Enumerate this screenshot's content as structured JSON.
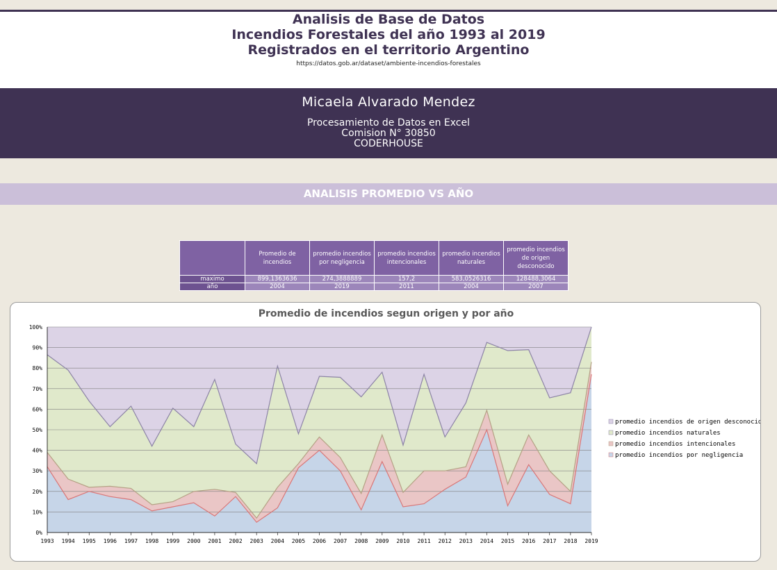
{
  "header": {
    "title_lines": [
      "Analisis de Base de Datos",
      "Incendios Forestales del año 1993 al 2019",
      "Registrados en el territorio Argentino"
    ],
    "source_url": "https://datos.gob.ar/dataset/ambiente-incendios-forestales"
  },
  "author": {
    "name": "Micaela Alvarado Mendez",
    "course_lines": [
      "Procesamiento de Datos en Excel",
      "Comision N° 30850",
      "CODERHOUSE"
    ]
  },
  "section": {
    "title": "ANALISIS PROMEDIO VS AÑO"
  },
  "summary_table": {
    "columns": [
      "",
      "Promedio de incendios",
      "promedio incendios por negligencia",
      "promedio incendios intencionales",
      "promedio incendios naturales",
      "promedio incendios de origen desconocido"
    ],
    "rows": [
      {
        "label": "maximo",
        "values": [
          "899,1363636",
          "274,3888889",
          "157,2",
          "583,0526316",
          "128488,3064"
        ]
      },
      {
        "label": "año",
        "values": [
          "2004",
          "2019",
          "2011",
          "2004",
          "2007"
        ]
      }
    ]
  },
  "colors": {
    "negligencia": "#c6d5e8",
    "intencionales": "#eac6c6",
    "naturales": "#e0e9cb",
    "desconocido": "#dcd3e6",
    "line_negligencia": "#d97677",
    "line_intencionales": "#b4a184",
    "line_naturales": "#8c83a6",
    "header_purple": "#3f3253"
  },
  "chart_data": {
    "type": "area",
    "stacking": "percent",
    "title": "Promedio de incendios segun origen y por año",
    "x": [
      "1993",
      "1994",
      "1995",
      "1996",
      "1997",
      "1998",
      "1999",
      "2000",
      "2001",
      "2002",
      "2003",
      "2004",
      "2005",
      "2006",
      "2007",
      "2008",
      "2009",
      "2010",
      "2011",
      "2012",
      "2013",
      "2014",
      "2015",
      "2016",
      "2017",
      "2018",
      "2019"
    ],
    "y_ticks": [
      "0%",
      "10%",
      "20%",
      "30%",
      "40%",
      "50%",
      "60%",
      "70%",
      "80%",
      "90%",
      "100%"
    ],
    "ylim": [
      0,
      100
    ],
    "grid": true,
    "legend_position": "right",
    "series": [
      {
        "name": "promedio incendios por negligencia",
        "values": [
          32,
          16,
          20,
          17.5,
          16,
          10.5,
          12.5,
          14.5,
          8,
          17.5,
          5,
          12,
          31.5,
          40,
          30,
          11,
          34.5,
          12.5,
          14,
          21,
          27,
          50,
          13,
          33,
          18.5,
          14,
          77
        ]
      },
      {
        "name": "promedio incendios intencionales",
        "values": [
          7,
          10,
          2,
          5,
          5.5,
          3,
          2.5,
          5.5,
          13,
          2,
          2,
          10,
          2,
          6.5,
          6.5,
          8,
          13,
          7,
          16,
          9,
          5,
          9.5,
          10.5,
          14.5,
          11.5,
          6,
          6
        ]
      },
      {
        "name": "promedio incendios naturales",
        "values": [
          47.5,
          53,
          42,
          29,
          40,
          28.5,
          45.5,
          31.5,
          53.5,
          23.5,
          26.5,
          59,
          14.5,
          29.5,
          39,
          47,
          30.5,
          23,
          47,
          16.5,
          31,
          33,
          65,
          41.5,
          35.5,
          48,
          17
        ]
      },
      {
        "name": "promedio incendios de origen desconocido",
        "values": [
          13.5,
          21,
          36,
          48.5,
          38.5,
          58,
          39.5,
          48.5,
          25.5,
          57,
          66.5,
          19,
          52,
          24,
          24.5,
          34,
          22,
          57.5,
          23,
          53.5,
          37,
          7.5,
          11.5,
          11,
          34.5,
          32,
          0
        ]
      }
    ]
  }
}
